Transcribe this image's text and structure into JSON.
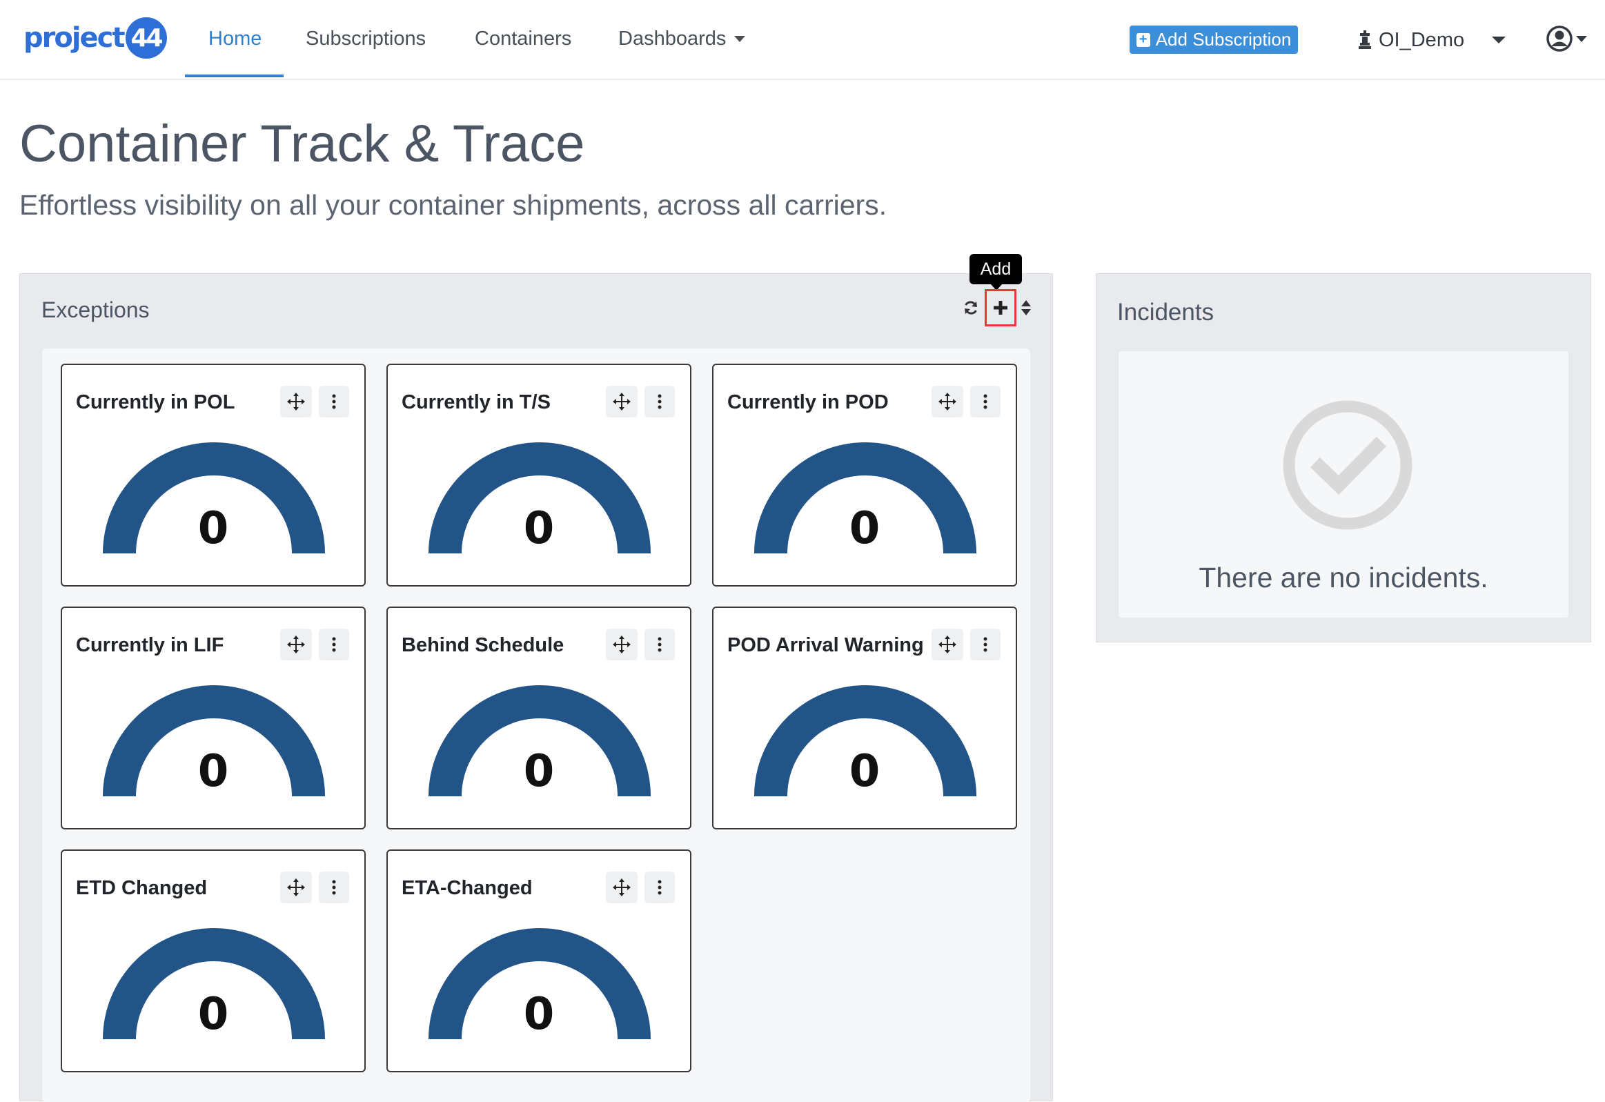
{
  "brand": {
    "logo_text": "project",
    "logo_badge": "44"
  },
  "nav": {
    "items": [
      {
        "label": "Home",
        "active": true
      },
      {
        "label": "Subscriptions"
      },
      {
        "label": "Containers"
      },
      {
        "label": "Dashboards",
        "has_dropdown": true
      }
    ],
    "add_subscription_label": "Add Subscription",
    "user_label": "OI_Demo"
  },
  "page": {
    "title": "Container Track & Trace",
    "subtitle": "Effortless visibility on all your container shipments, across all carriers."
  },
  "exceptions": {
    "title": "Exceptions",
    "tooltip": "Add",
    "cards": [
      {
        "title": "Currently in POL",
        "value": "0"
      },
      {
        "title": "Currently in T/S",
        "value": "0"
      },
      {
        "title": "Currently in POD",
        "value": "0"
      },
      {
        "title": "Currently in LIF",
        "value": "0"
      },
      {
        "title": "Behind Schedule",
        "value": "0"
      },
      {
        "title": "POD Arrival Warning",
        "value": "0"
      },
      {
        "title": "ETD Changed",
        "value": "0"
      },
      {
        "title": "ETA-Changed",
        "value": "0"
      }
    ]
  },
  "incidents": {
    "title": "Incidents",
    "empty_message": "There are no incidents."
  },
  "colors": {
    "accent": "#2f80d1",
    "gauge": "#225487",
    "highlight": "#e53935"
  },
  "icons": [
    "refresh-icon",
    "plus-icon",
    "sort-icon",
    "move-icon",
    "more-vertical-icon",
    "check-circle-icon",
    "user-icon",
    "chess-piece-icon",
    "plus-square-icon"
  ]
}
